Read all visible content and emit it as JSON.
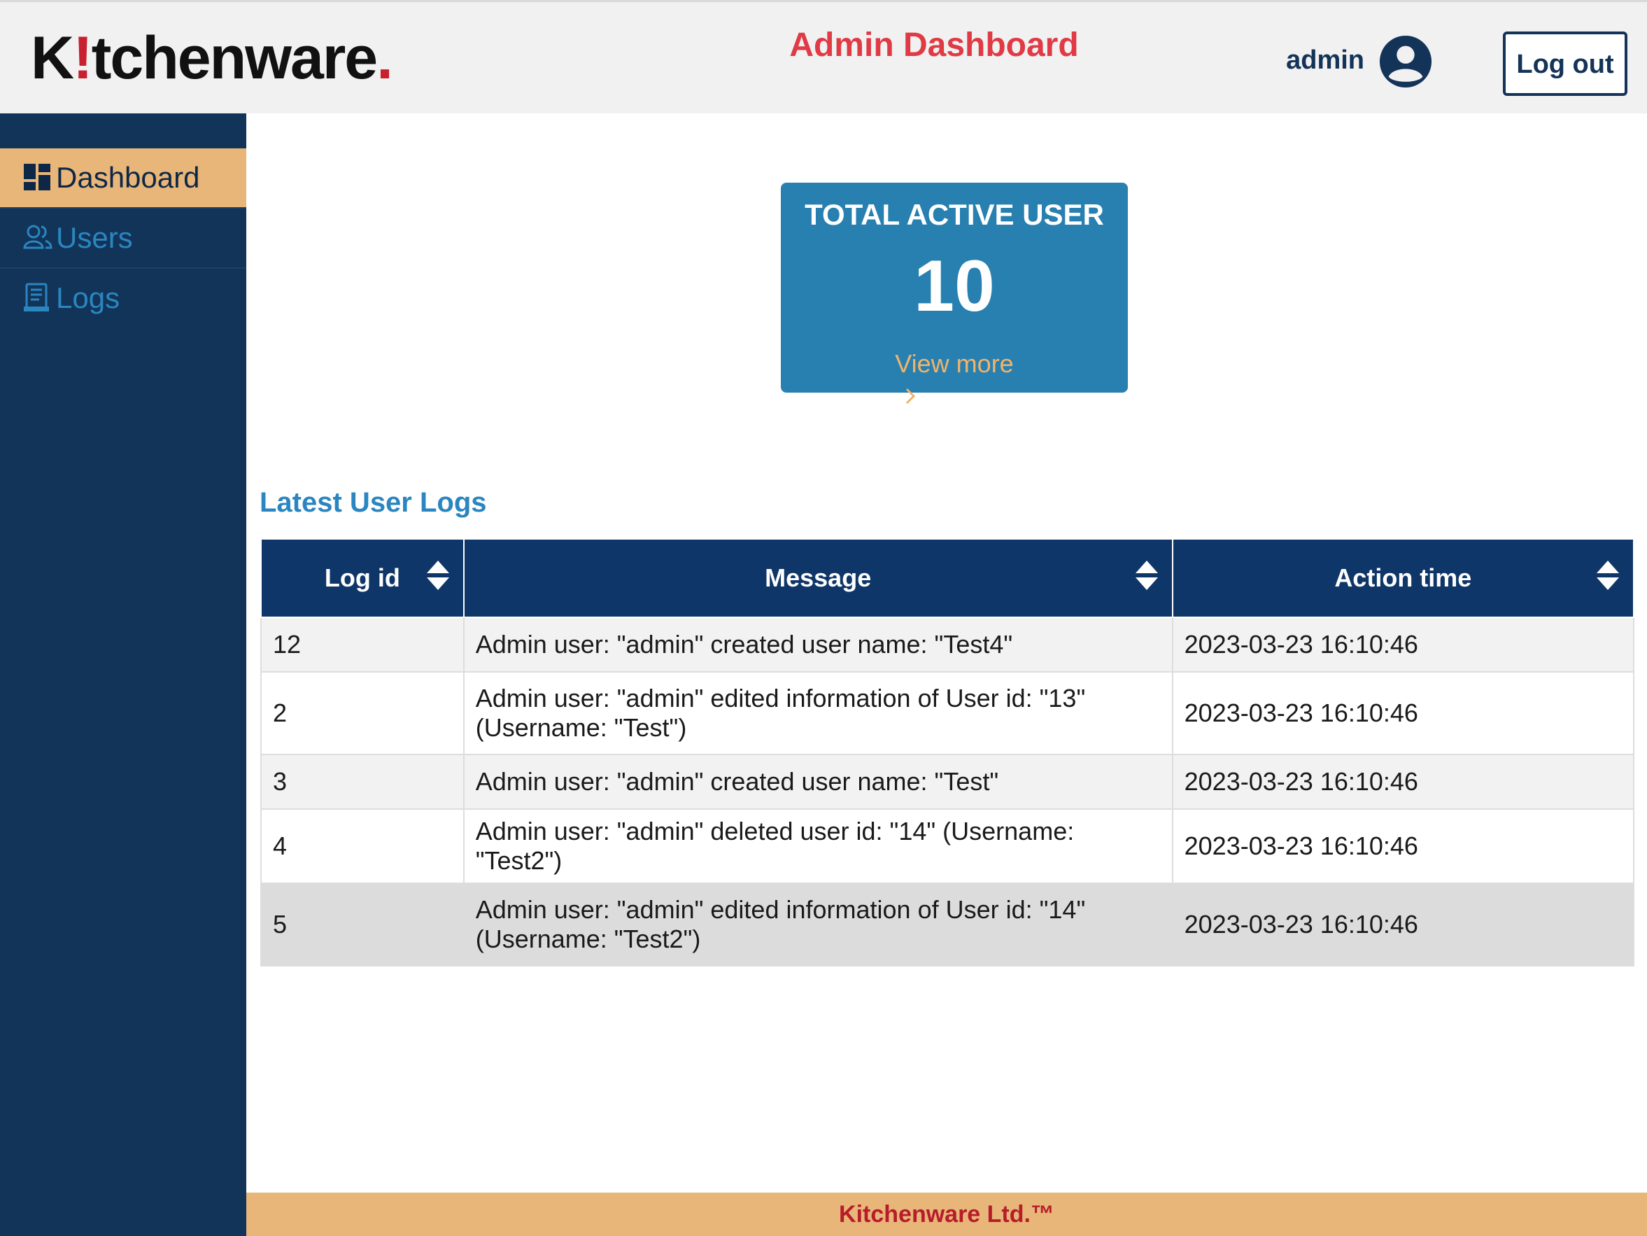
{
  "header": {
    "logo": {
      "k": "K",
      "bang": "!",
      "rest": "tchenware",
      "dot": "."
    },
    "title": "Admin Dashboard",
    "username": "admin",
    "logout_label": "Log out"
  },
  "sidebar": {
    "items": [
      {
        "label": "Dashboard",
        "icon": "dashboard-icon",
        "active": true
      },
      {
        "label": "Users",
        "icon": "users-icon",
        "active": false
      },
      {
        "label": "Logs",
        "icon": "logs-icon",
        "active": false
      }
    ]
  },
  "stats": {
    "title": "TOTAL ACTIVE USER",
    "value": "10",
    "link": "View more"
  },
  "logs": {
    "title": "Latest User Logs",
    "columns": [
      "Log id",
      "Message",
      "Action time"
    ],
    "rows": [
      {
        "id": "12",
        "message": "Admin user: \"admin\" created user name: \"Test4\"",
        "time": "2023-03-23 16:10:46"
      },
      {
        "id": "2",
        "message": "Admin user: \"admin\" edited information of User id: \"13\" (Username: \"Test\")",
        "time": "2023-03-23 16:10:46"
      },
      {
        "id": "3",
        "message": "Admin user: \"admin\" created user name: \"Test\"",
        "time": "2023-03-23 16:10:46"
      },
      {
        "id": "4",
        "message": "Admin user: \"admin\" deleted user id: \"14\" (Username: \"Test2\")",
        "time": "2023-03-23 16:10:46"
      },
      {
        "id": "5",
        "message": "Admin user: \"admin\" edited information of User id: \"14\" (Username: \"Test2\")",
        "time": "2023-03-23 16:10:46"
      }
    ]
  },
  "footer": {
    "text": "Kitchenware Ltd.™"
  },
  "colors": {
    "navy": "#133459",
    "accent_orange": "#e8b679",
    "card_blue": "#2880b0",
    "title_red": "#e03a45",
    "table_header": "#0f3668"
  }
}
